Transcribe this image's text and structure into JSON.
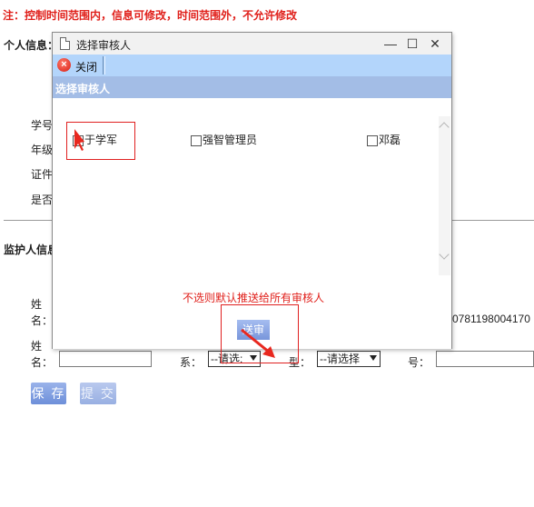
{
  "notice": "注：控制时间范围内，信息可修改，时间范围外，不允许修改",
  "sections": {
    "personal": "个人信息：",
    "guardian": "监护人信息"
  },
  "personal_fields": [
    "学号",
    "年级",
    "证件",
    "是否"
  ],
  "guardian": {
    "name_label_1a": "姓",
    "name_label_1b": "名：",
    "name_label_2a": "姓",
    "name_label_2b": "名：",
    "relation_label": "系：",
    "relation_value": "--请选:",
    "type_label": "型：",
    "type_value": "--请选择",
    "number_label": "号：",
    "id_value": "0781198004170"
  },
  "buttons": {
    "save": "保 存",
    "submit": "提 交"
  },
  "dialog": {
    "title": "选择审核人",
    "close_label": "关闭",
    "header": "选择审核人",
    "reviewers": [
      {
        "name": "于学军",
        "checked": false
      },
      {
        "name": "强智管理员",
        "checked": false
      },
      {
        "name": "邓磊",
        "checked": false
      }
    ],
    "hint": "不选则默认推送给所有审核人",
    "send_label": "送审"
  },
  "window_controls": {
    "minimize": "—",
    "maximize": "☐",
    "close": "✕"
  }
}
